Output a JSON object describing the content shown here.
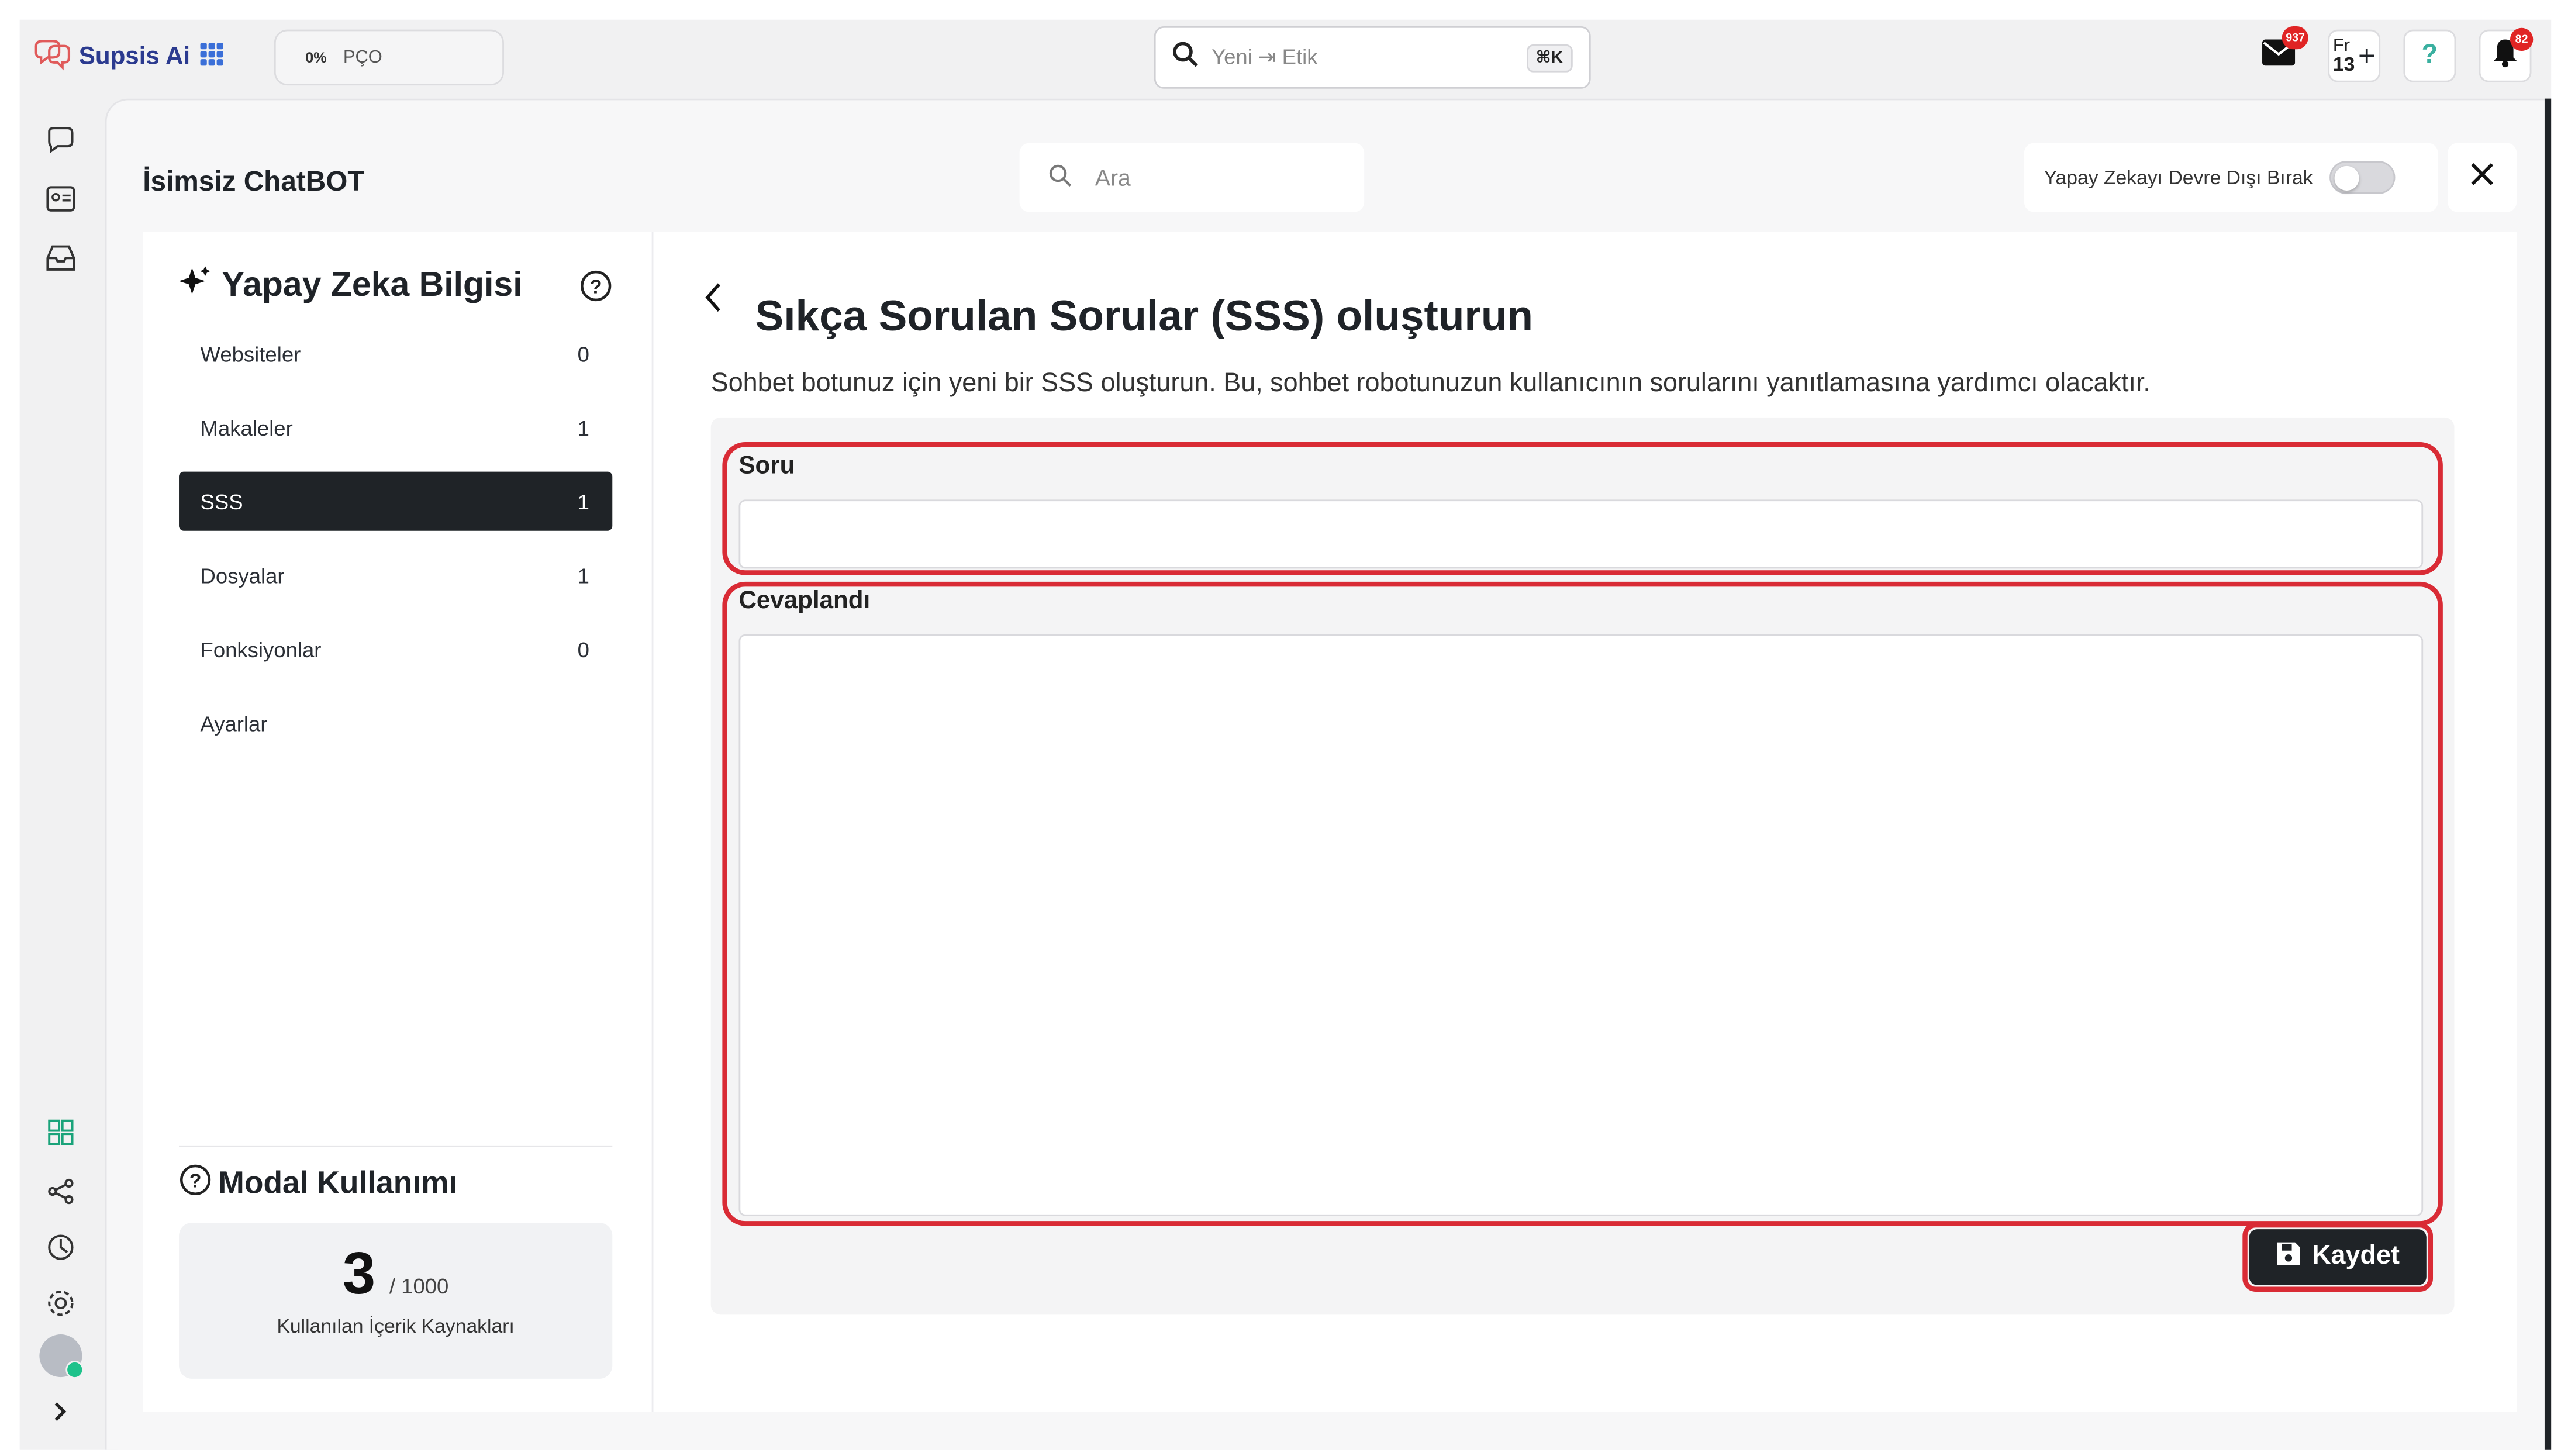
{
  "brand": {
    "name": "Supsis Ai"
  },
  "topbar": {
    "progress_percent": "0%",
    "progress_label": "PÇO",
    "search_placeholder": "Yeni ⇥ Etik",
    "search_shortcut": "⌘K",
    "mail_badge": "937",
    "fr_label_top": "Fr",
    "fr_label_bottom": "13",
    "notif_badge": "82"
  },
  "panel": {
    "title": "İsimsiz ChatBOT",
    "search_placeholder": "Ara",
    "ai_toggle_label": "Yapay Zekayı Devre Dışı Bırak",
    "ai_toggle_on": false
  },
  "knowledge": {
    "title": "Yapay Zeka Bilgisi",
    "items": [
      {
        "label": "Websiteler",
        "count": "0",
        "active": false
      },
      {
        "label": "Makaleler",
        "count": "1",
        "active": false
      },
      {
        "label": "SSS",
        "count": "1",
        "active": true
      },
      {
        "label": "Dosyalar",
        "count": "1",
        "active": false
      },
      {
        "label": "Fonksiyonlar",
        "count": "0",
        "active": false
      },
      {
        "label": "Ayarlar",
        "count": "",
        "active": false
      }
    ]
  },
  "usage": {
    "title": "Modal Kullanımı",
    "used": "3",
    "max": "/ 1000",
    "caption": "Kullanılan İçerik Kaynakları"
  },
  "content": {
    "title": "Sıkça Sorulan Sorular (SSS) oluşturun",
    "subtitle": "Sohbet botunuz için yeni bir SSS oluşturun. Bu, sohbet robotunuzun kullanıcının sorularını yanıtlamasına yardımcı olacaktır.",
    "question_label": "Soru",
    "question_value": "",
    "answer_label": "Cevaplandı",
    "answer_value": "",
    "save_label": "Kaydet"
  },
  "colors": {
    "highlight": "#d92b35",
    "active_item": "#1f2327",
    "brand": "#2b3a8f"
  }
}
